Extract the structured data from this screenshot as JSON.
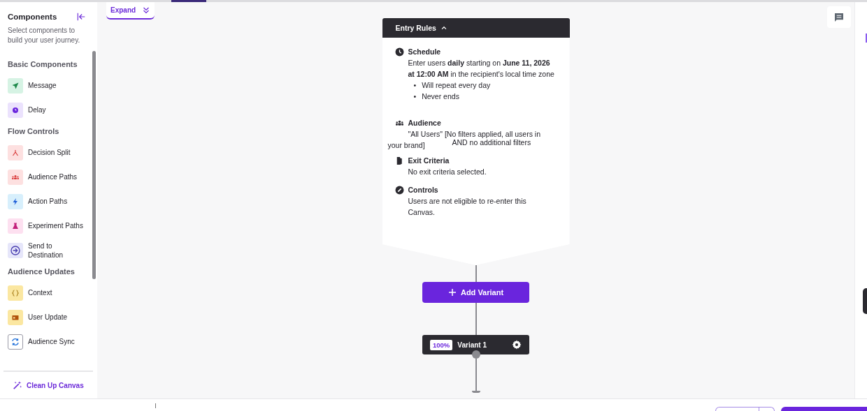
{
  "sidebar": {
    "title": "Components",
    "subtitle": "Select components to build your user journey.",
    "sections": [
      {
        "title": "Basic Components",
        "items": [
          {
            "label": "Message",
            "kind": "send",
            "color": "#d6f3e4"
          },
          {
            "label": "Delay",
            "kind": "clock",
            "color": "#ebe2fd"
          }
        ]
      },
      {
        "title": "Flow Controls",
        "items": [
          {
            "label": "Decision Split",
            "kind": "split",
            "color": "#fde0e0"
          },
          {
            "label": "Audience Paths",
            "kind": "people",
            "color": "#fde0e0"
          },
          {
            "label": "Action Paths",
            "kind": "bolt",
            "color": "#d7effc"
          },
          {
            "label": "Experiment Paths",
            "kind": "flask",
            "color": "#fde0f0"
          },
          {
            "label": "Send to Destination",
            "kind": "destination",
            "color": "#e6e6fa"
          }
        ]
      },
      {
        "title": "Audience Updates",
        "items": [
          {
            "label": "Context",
            "kind": "context",
            "color": "#fbe7a1"
          },
          {
            "label": "User Update",
            "kind": "update",
            "color": "#fbe7a1"
          },
          {
            "label": "Audience Sync",
            "kind": "sync",
            "color": "#ffffff"
          }
        ]
      }
    ],
    "footer_action": "Clean Up Canvas"
  },
  "canvas": {
    "expand_label": "Expand",
    "entry_rules": {
      "title": "Entry Rules",
      "expanded": true,
      "schedule": {
        "title": "Schedule",
        "text": "Enter users **daily** starting on **June 11, 2026 at 12:00 AM** in the recipient's local time zone",
        "bullets": [
          {
            "marker": "•",
            "text": "Will repeat every day"
          },
          {
            "marker": "•",
            "text": "Never ends"
          }
        ]
      },
      "audience": {
        "title": "Audience",
        "line_1": "\"All Users\" [No filters applied, all users in",
        "line_2": "your brand]",
        "line_3": "AND no additional filters"
      },
      "exit_criteria": {
        "title": "Exit Criteria",
        "text": "No exit criteria selected."
      },
      "controls": {
        "title": "Controls",
        "text": "Users are not eligible to re-enter this Canvas."
      }
    },
    "add_variant": "Add Variant",
    "variant": {
      "percent": "100%",
      "name": "Variant 1"
    }
  }
}
